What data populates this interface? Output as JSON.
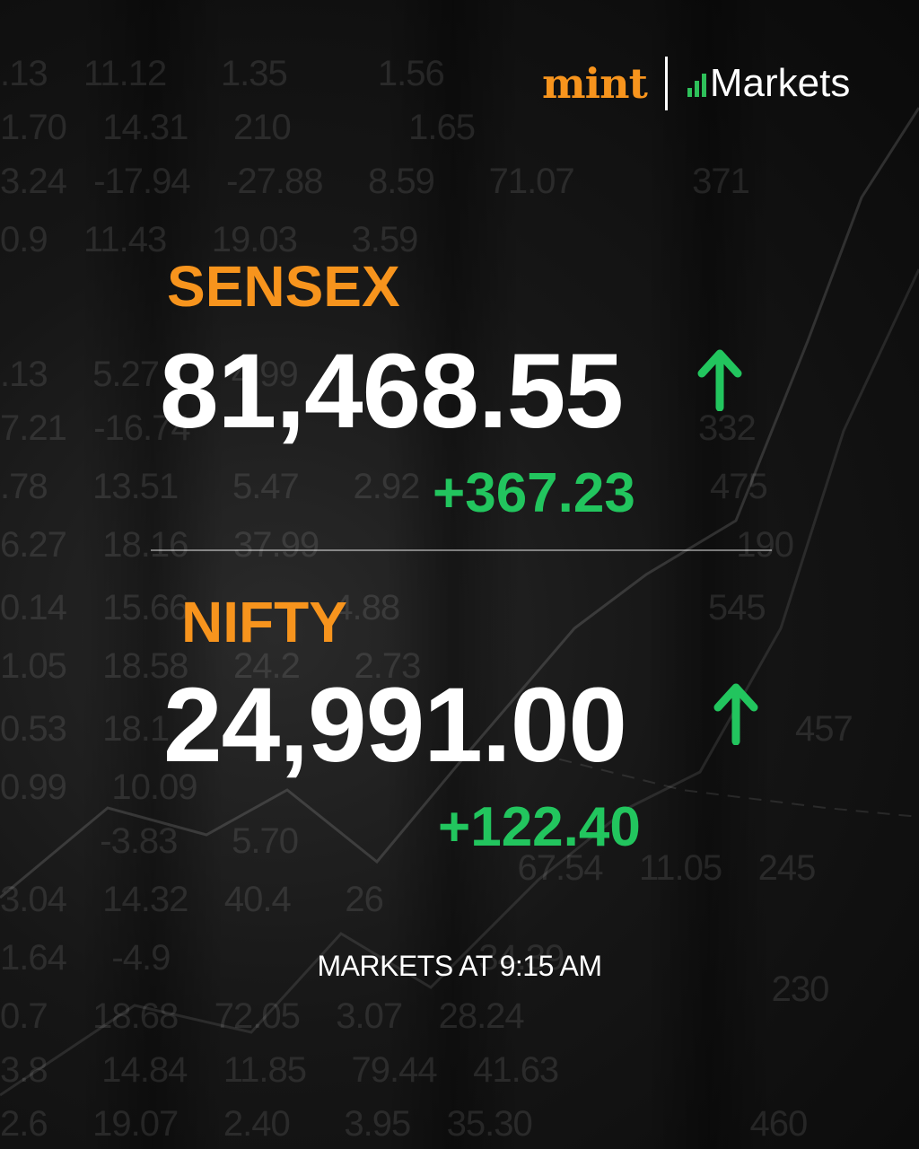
{
  "brand": {
    "mint": "mint",
    "markets": "Markets",
    "mint_color": "#f7941d",
    "bars_icon": "bar-chart-icon"
  },
  "indices": [
    {
      "name": "SENSEX",
      "value": "81,468.55",
      "change": "+367.23",
      "direction": "up"
    },
    {
      "name": "NIFTY",
      "value": "24,991.00",
      "change": "+122.40",
      "direction": "up"
    }
  ],
  "timestamp": "MARKETS AT 9:15 AM",
  "colors": {
    "label": "#f7941d",
    "value": "#ffffff",
    "positive": "#22c55e",
    "background": "#111111"
  }
}
